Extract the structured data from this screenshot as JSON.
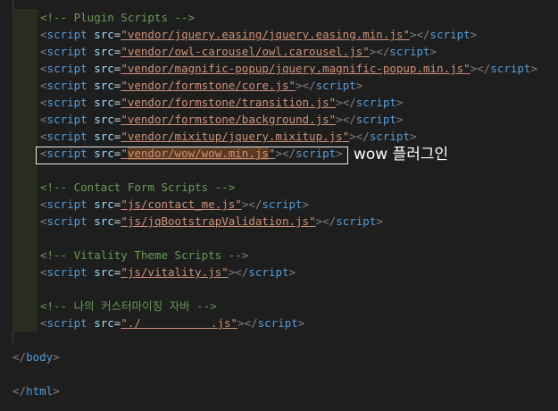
{
  "editor": {
    "lines": [
      {
        "type": "comment",
        "text": "<!-- Plugin Scripts -->"
      },
      {
        "type": "script",
        "src": "vendor/jquery.easing/jquery.easing.min.js"
      },
      {
        "type": "script",
        "src": "vendor/owl-carousel/owl.carousel.js"
      },
      {
        "type": "script",
        "src": "vendor/magnific-popup/jquery.magnific-popup.min.js"
      },
      {
        "type": "script",
        "src": "vendor/formstone/core.js"
      },
      {
        "type": "script",
        "src": "vendor/formstone/transition.js"
      },
      {
        "type": "script",
        "src": "vendor/formstone/background.js"
      },
      {
        "type": "script",
        "src": "vendor/mixitup/jquery.mixitup.js"
      },
      {
        "type": "script",
        "src": "vendor/wow/wow.min.js"
      },
      {
        "type": "blank"
      },
      {
        "type": "comment",
        "text": "<!-- Contact Form Scripts -->"
      },
      {
        "type": "script",
        "src": "js/contact_me.js"
      },
      {
        "type": "script",
        "src": "js/jqBootstrapValidation.js"
      },
      {
        "type": "blank"
      },
      {
        "type": "comment",
        "text": "<!-- Vitality Theme Scripts -->"
      },
      {
        "type": "script",
        "src": "js/vitality.js"
      },
      {
        "type": "blank"
      },
      {
        "type": "comment",
        "text": "<!-- 나의 커스터마이징 자바 -->"
      },
      {
        "type": "script",
        "src_prefix": "./",
        "src_suffix": ".js"
      },
      {
        "type": "blank"
      },
      {
        "type": "close",
        "text": "</body>"
      },
      {
        "type": "blank"
      },
      {
        "type": "close",
        "text": "</html>"
      }
    ],
    "tokens": {
      "open": "<",
      "tag": "script",
      "attr": "src",
      "eq": "=",
      "quote": "\"",
      "gt": ">",
      "close_open": "</",
      "close_gt": ">"
    }
  },
  "annotation": {
    "label": "wow 플러그인"
  },
  "colors": {
    "background": "#1e1e1e",
    "comment": "#6a9955",
    "tag": "#569cd6",
    "attribute": "#9cdcfe",
    "string": "#ce9178",
    "punctuation": "#808080"
  }
}
